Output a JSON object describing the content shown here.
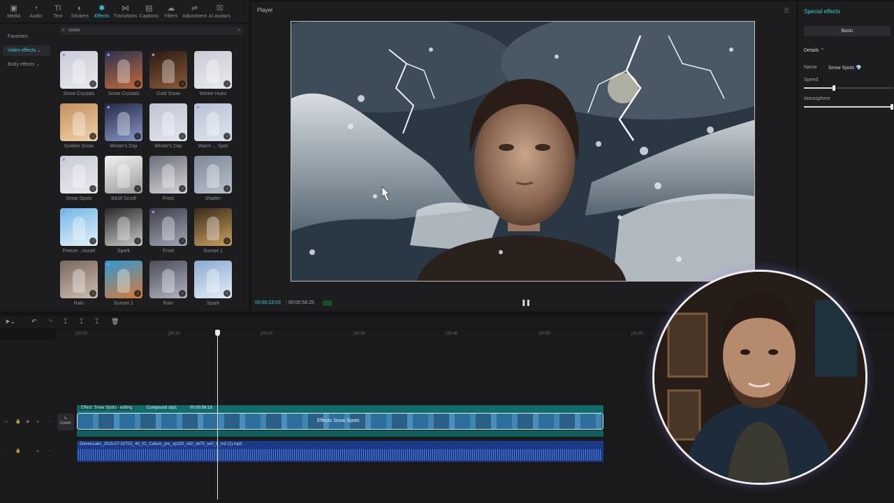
{
  "toolbar": {
    "items": [
      {
        "label": "Media",
        "icon": "media-icon",
        "glyph": "▣"
      },
      {
        "label": "Audio",
        "icon": "audio-icon",
        "glyph": "◔"
      },
      {
        "label": "Text",
        "icon": "text-icon",
        "glyph": "TI"
      },
      {
        "label": "Stickers",
        "icon": "stickers-icon",
        "glyph": "◐"
      },
      {
        "label": "Effects",
        "icon": "effects-icon",
        "glyph": "✱"
      },
      {
        "label": "Transitions",
        "icon": "transitions-icon",
        "glyph": "⋈"
      },
      {
        "label": "Captions",
        "icon": "captions-icon",
        "glyph": "▤"
      },
      {
        "label": "Filters",
        "icon": "filters-icon",
        "glyph": "☁"
      },
      {
        "label": "Adjustment",
        "icon": "adjustment-icon",
        "glyph": "⇌"
      },
      {
        "label": "AI avatars",
        "icon": "ai-avatars-icon",
        "glyph": "☒"
      }
    ],
    "active": "Effects"
  },
  "sidebar": {
    "items": [
      {
        "label": "Favorites"
      },
      {
        "label": "Video effects ⌄"
      },
      {
        "label": "Body effects ⌄"
      }
    ]
  },
  "search": {
    "value": "snow",
    "clear": "×"
  },
  "effects": [
    {
      "label": "Snow Crystals",
      "colors": [
        "#c9ccd6",
        "#e9e9ef"
      ],
      "gem": true
    },
    {
      "label": "Snow Crystals",
      "colors": [
        "#2a3350",
        "#c56a3a"
      ],
      "gem": true
    },
    {
      "label": "Gold Snow",
      "colors": [
        "#2a1a12",
        "#8a5a3a"
      ],
      "gem": true
    },
    {
      "label": "Winter Hues",
      "colors": [
        "#c9ccd6",
        "#e9e9ef"
      ],
      "gem": false
    },
    {
      "label": "Golden Snow",
      "colors": [
        "#c4905e",
        "#f0d2a8"
      ],
      "gem": false
    },
    {
      "label": "Winter's Day",
      "colors": [
        "#222a44",
        "#8a96c8"
      ],
      "gem": true
    },
    {
      "label": "Winter's Day",
      "colors": [
        "#bfc4d2",
        "#e3e6ee"
      ],
      "gem": false
    },
    {
      "label": "Warm ... Spot",
      "colors": [
        "#b8c2d6",
        "#dfe4ee"
      ],
      "gem": true
    },
    {
      "label": "Snow Spots",
      "colors": [
        "#c9ccd6",
        "#e9e9ef"
      ],
      "gem": true
    },
    {
      "label": "B&W Scroll",
      "colors": [
        "#f2f2f2",
        "#9a9a9a"
      ],
      "gem": false
    },
    {
      "label": "Frost",
      "colors": [
        "#6b6e78",
        "#d6d6dc"
      ],
      "gem": false
    },
    {
      "label": "Shatter",
      "colors": [
        "#7d8796",
        "#b9c3cf"
      ],
      "gem": false
    },
    {
      "label": "Freeze...rousel",
      "colors": [
        "#6fb6e6",
        "#e6f2fa"
      ],
      "gem": true
    },
    {
      "label": "Spark",
      "colors": [
        "#2a2a2a",
        "#c9c9c9"
      ],
      "gem": false
    },
    {
      "label": "Frost",
      "colors": [
        "#3b3d4a",
        "#a5a7b6"
      ],
      "gem": true
    },
    {
      "label": "Sunset 1",
      "colors": [
        "#3a2a1a",
        "#caa060"
      ],
      "gem": false
    },
    {
      "label": "Rain",
      "colors": [
        "#7a6a5e",
        "#cbbdae"
      ],
      "gem": false
    },
    {
      "label": "Sunset 1",
      "colors": [
        "#2e9ad0",
        "#d87a3a"
      ],
      "gem": true
    },
    {
      "label": "Rain",
      "colors": [
        "#4a4c58",
        "#b2b4c2"
      ],
      "gem": false
    },
    {
      "label": "Spark",
      "colors": [
        "#8aaad0",
        "#e6eef8"
      ],
      "gem": false
    }
  ],
  "player": {
    "title": "Player",
    "current_time": "00:00:15:03",
    "separator": "|",
    "total_time": "00:00:56:25",
    "pause": "❚❚"
  },
  "props": {
    "title": "Special effects",
    "tab": "Basic",
    "details": "Details ⌃",
    "name_label": "Name",
    "name_value": "Snow Spots 💎",
    "speed_label": "Speed",
    "speed_value": 0.32,
    "atmosphere_label": "Atmosphere",
    "atmosphere_value": 1.0
  },
  "timeline": {
    "ruler": [
      "00:00",
      "00:10",
      "00:20",
      "00:30",
      "00:40",
      "00:50",
      "01:00"
    ],
    "effect_label": "Effect: Snow Spots - editing",
    "compound_label": "Compound clip1",
    "clip_duration": "00:00:56:19",
    "cover_label": "Cover",
    "video_clip_label": "Effects   Snow Spots",
    "audio_label": "ElevenLabs_2025-07-02T02_40_01_Callum_pre_sp100_s50_sb75_se0_b_m2 (1).mp3"
  }
}
